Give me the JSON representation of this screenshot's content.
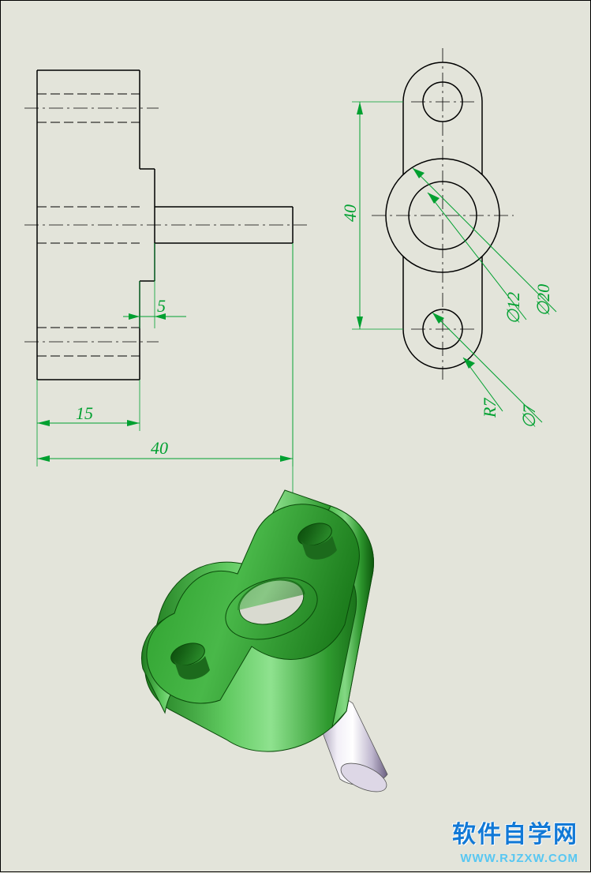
{
  "chart_data": {
    "type": "engineering_drawing",
    "title": "",
    "units": "mm",
    "views": [
      "side",
      "front",
      "isometric"
    ],
    "dimensions": {
      "base_depth": 15,
      "step_depth": 5,
      "shaft_length_total": 40,
      "lobe_center_distance": 40,
      "boss_outer_dia": 20,
      "boss_inner_dia": 12,
      "lobe_outer_radius": 7,
      "lobe_hole_dia": 7
    },
    "labels": {
      "d15": "15",
      "d5": "5",
      "d40_h": "40",
      "d40_v": "40",
      "dia20": "20",
      "dia12": "12",
      "r7": "R7",
      "dia7": "7",
      "phi": "∅"
    }
  },
  "watermark": {
    "line1": "软件自学网",
    "line2": "WWW.RJZXW.COM"
  }
}
